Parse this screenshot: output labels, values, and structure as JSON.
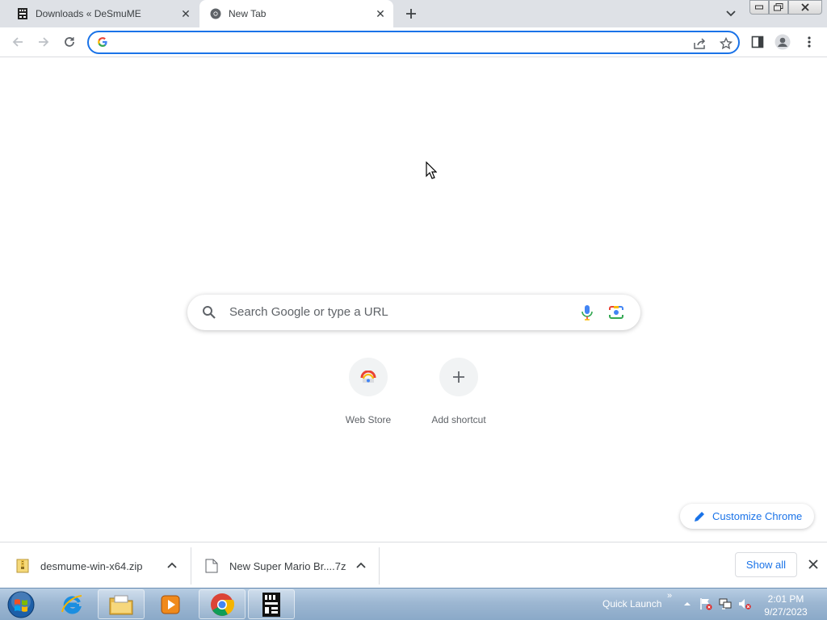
{
  "tabs": [
    {
      "title": "Downloads « DeSmuME",
      "favicon": "desmume-icon",
      "active": false
    },
    {
      "title": "New Tab",
      "favicon": "chrome-icon",
      "active": true
    }
  ],
  "omnibox": {
    "value": "",
    "placeholder": ""
  },
  "ntp": {
    "search_placeholder": "Search Google or type a URL",
    "shortcuts": [
      {
        "label": "Web Store",
        "icon": "web-store-icon"
      },
      {
        "label": "Add shortcut",
        "icon": "plus-icon"
      }
    ],
    "customize_label": "Customize Chrome"
  },
  "downloads": {
    "items": [
      {
        "name": "desmume-win-x64.zip",
        "icon": "zip-file-icon"
      },
      {
        "name": "New Super Mario Br....7z",
        "icon": "file-icon"
      }
    ],
    "show_all": "Show all"
  },
  "taskbar": {
    "quick_launch": "Quick Launch",
    "quick_launch_chevron": "»",
    "time": "2:01 PM",
    "date": "9/27/2023",
    "apps": [
      "internet-explorer-icon",
      "file-explorer-icon",
      "media-player-icon",
      "chrome-icon",
      "desmume-icon"
    ]
  },
  "colors": {
    "accent": "#1a73e8",
    "tabstrip": "#dee1e6",
    "taskbar": "#9db7d2"
  }
}
